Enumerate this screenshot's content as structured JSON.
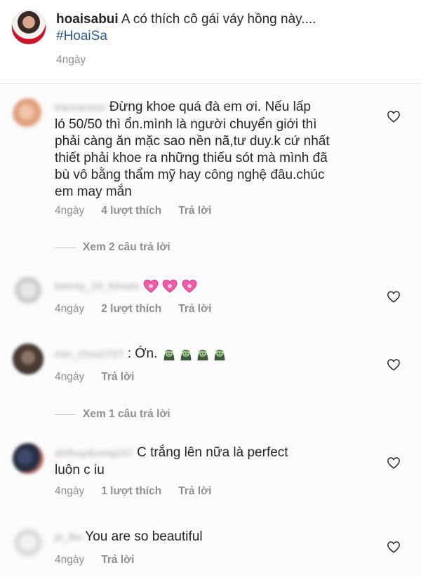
{
  "caption": {
    "username": "hoaisabui",
    "text": "A có thích cô gái váy hồng này....",
    "hashtag": "#HoaiSa",
    "time": "4ngày"
  },
  "comments": [
    {
      "username": "tranvanxxx",
      "text_line1": "Đừng khoe quá đà em ơi. Nếu lấp",
      "text_lines": [
        "ló 50/50 thì ổn.mình là người chuyển giới thì",
        "phải càng ăn mặc sao nền nã,tư duy.k cứ nhất",
        "thiết phải khoe ra những thiếu sót mà mình đã",
        "bù vô bằng thẩm mỹ hay công nghệ đâu.chúc",
        "em may mắn"
      ],
      "time": "4ngày",
      "likes": "4 lượt thích",
      "reply": "Trả lời",
      "view_replies": "Xem 2 câu trả lời"
    },
    {
      "username": "twenty_20_fshoes",
      "emoji": [
        "pink-heart",
        "pink-heart",
        "pink-heart"
      ],
      "time": "4ngày",
      "likes": "2 lượt thích",
      "reply": "Trả lời"
    },
    {
      "username": "min_chou2707",
      "text": ": Ớn.",
      "emoji": [
        "zombie-face",
        "zombie-face",
        "zombie-face",
        "zombie-face"
      ],
      "time": "4ngày",
      "reply": "Trả lời",
      "view_replies": "Xem 1 câu trả lời"
    },
    {
      "username": "dothuyduong247",
      "text_line1": "C trắng lên nữa là perfect",
      "text_line2": "luôn c iu",
      "time": "4ngày",
      "likes": "1 lượt thích",
      "reply": "Trả lời"
    },
    {
      "username": "jn_flw",
      "text": "You are so beautiful",
      "time": "4ngày",
      "reply": "Trả lời"
    }
  ],
  "colors": {
    "text": "#262626",
    "meta": "#8e8e8e",
    "hashtag": "#2d5a8d",
    "emoji_heart": "#f05aa6"
  }
}
